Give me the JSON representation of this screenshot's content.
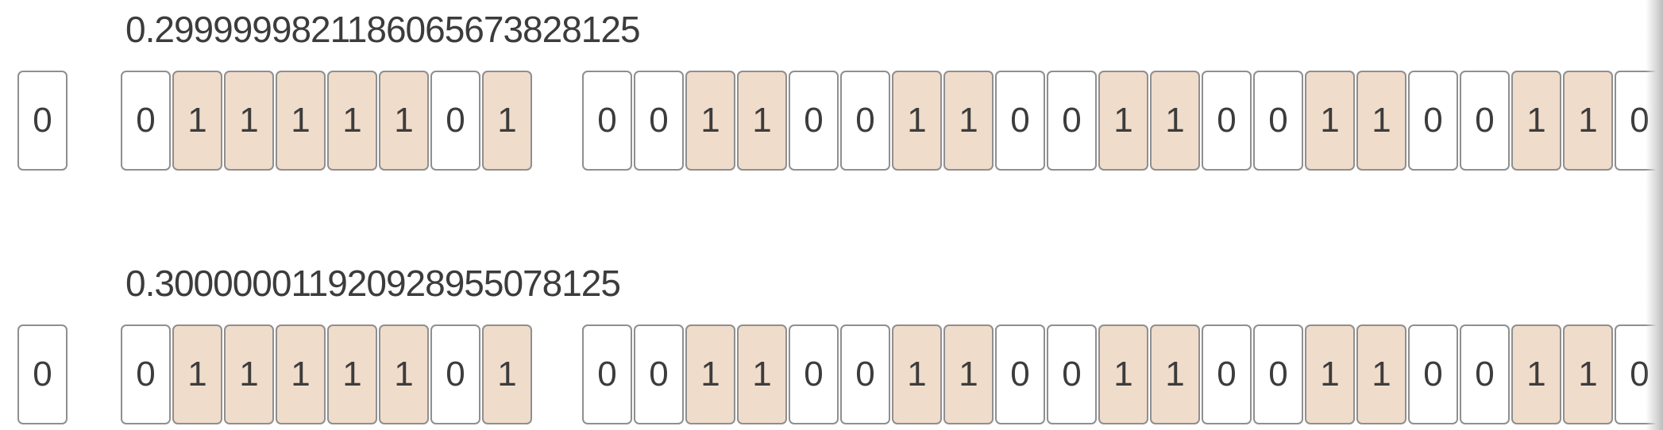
{
  "rows": [
    {
      "label": "0.2999999821186065673828125",
      "sign": [
        "0"
      ],
      "exponent": [
        "0",
        "1",
        "1",
        "1",
        "1",
        "1",
        "0",
        "1"
      ],
      "mantissa": [
        "0",
        "0",
        "1",
        "1",
        "0",
        "0",
        "1",
        "1",
        "0",
        "0",
        "1",
        "1",
        "0",
        "0",
        "1",
        "1",
        "0",
        "0",
        "1",
        "1",
        "0"
      ]
    },
    {
      "label": "0.300000011920928955078125",
      "sign": [
        "0"
      ],
      "exponent": [
        "0",
        "1",
        "1",
        "1",
        "1",
        "1",
        "0",
        "1"
      ],
      "mantissa": [
        "0",
        "0",
        "1",
        "1",
        "0",
        "0",
        "1",
        "1",
        "0",
        "0",
        "1",
        "1",
        "0",
        "0",
        "1",
        "1",
        "0",
        "0",
        "1",
        "1",
        "0"
      ]
    }
  ],
  "colors": {
    "bit_on_fill": "#f0dccb",
    "bit_off_fill": "#ffffff",
    "bit_border": "#8f8f8f",
    "text": "#3c3c3c"
  }
}
